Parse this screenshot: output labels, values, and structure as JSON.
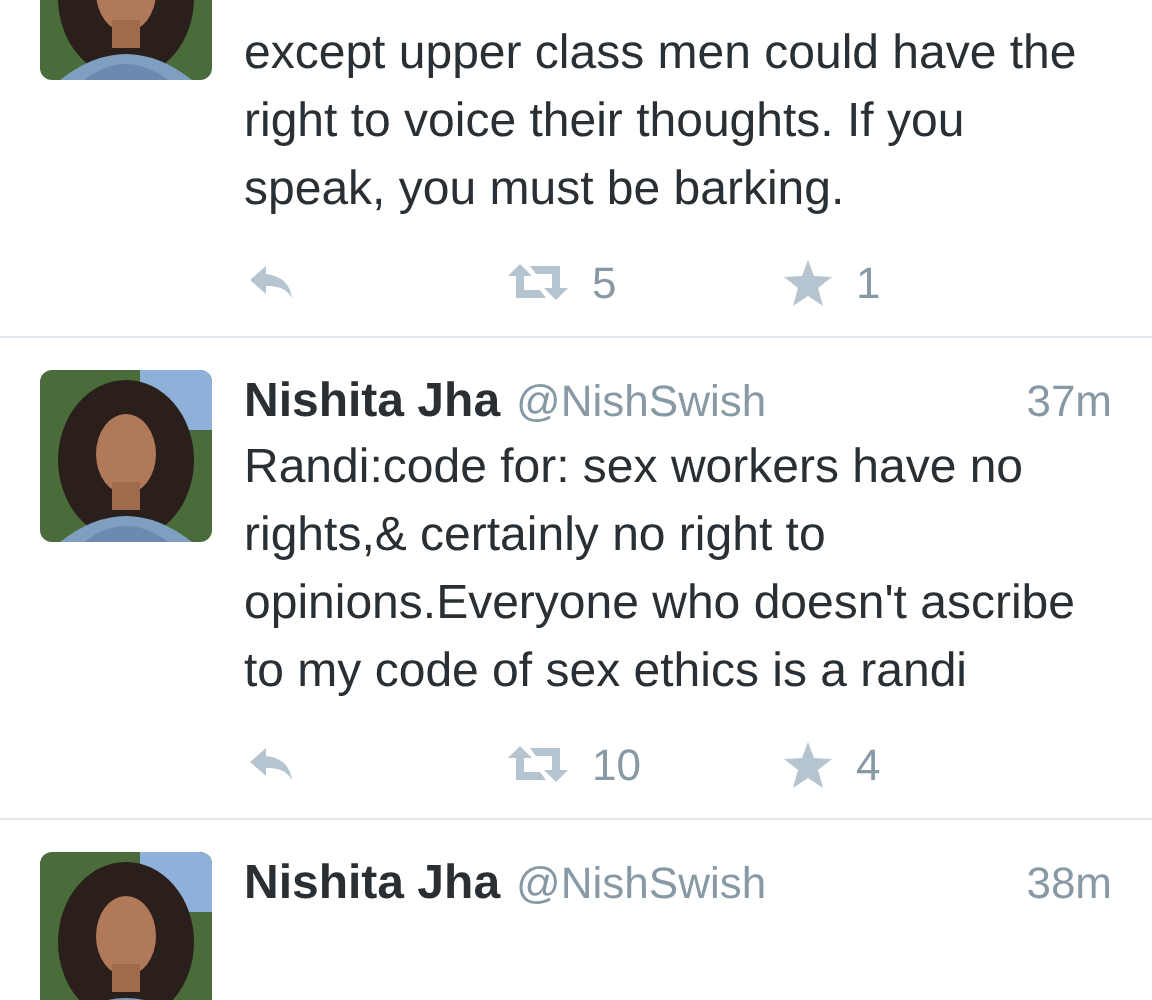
{
  "tweets": [
    {
      "text": "except upper class men could have the right to voice their thoughts. If you speak, you must be barking.",
      "retweets": "5",
      "favorites": "1"
    },
    {
      "name": "Nishita Jha",
      "handle": "@NishSwish",
      "time": "37m",
      "text": "Randi:code for: sex workers have no rights,& certainly no right to opinions.Everyone who doesn't ascribe to my code of sex ethics is a randi",
      "retweets": "10",
      "favorites": "4"
    },
    {
      "name": "Nishita Jha",
      "handle": "@NishSwish",
      "time": "38m"
    }
  ]
}
